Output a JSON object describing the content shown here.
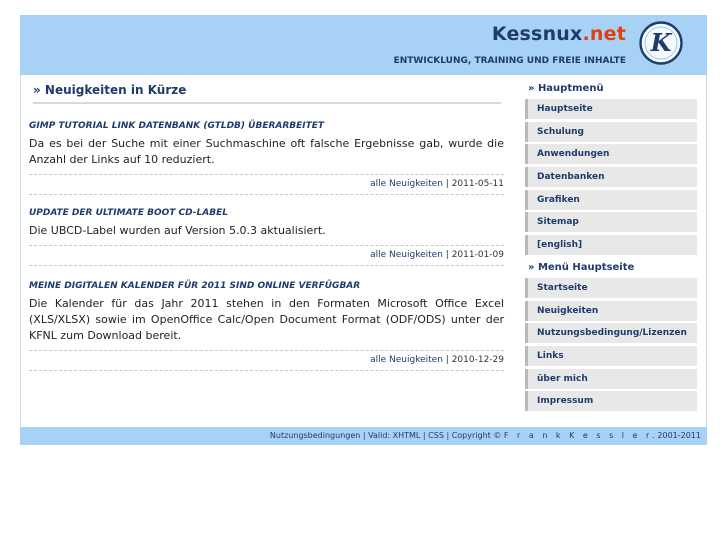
{
  "header": {
    "brand_name": "Kessnux",
    "brand_tld": ".net",
    "tagline": "ENTWICKLUNG, TRAINING UND FREIE INHALTE",
    "logo_letter": "K",
    "logo_icon": "k-circle-logo"
  },
  "content": {
    "title": "» Neuigkeiten in Kürze",
    "news": [
      {
        "title": "GIMP Tutorial Link Datenbank (GTLDB) überarbeitet",
        "body": "Da es bei der Suche mit einer Suchmaschine oft falsche Ergebnisse gab, wurde die Anzahl der Links auf 10 reduziert.",
        "link": "alle Neuigkeiten",
        "date": " | 2011-05-11"
      },
      {
        "title": "Update der Ultimate Boot CD-Label",
        "body": "Die UBCD-Label wurden auf Version 5.0.3 aktualisiert.",
        "link": "alle Neuigkeiten",
        "date": " | 2011-01-09"
      },
      {
        "title": "Meine digitalen Kalender für 2011 sind online verfügbar",
        "body": "Die Kalender für das Jahr 2011 stehen in den Formaten Microsoft Office Excel (XLS/XLSX) sowie im OpenOffice Calc/Open Document Format (ODF/ODS) unter der KFNL zum Download bereit.",
        "link": "alle Neuigkeiten",
        "date": " | 2010-12-29"
      }
    ]
  },
  "sidebar": {
    "main_heading": "» Hauptmenü",
    "main_items": [
      "Hauptseite",
      "Schulung",
      "Anwendungen",
      "Datenbanken",
      "Grafiken",
      "Sitemap",
      "[english]"
    ],
    "page_heading": "» Menü Hauptseite",
    "page_items": [
      "Startseite",
      "Neuigkeiten",
      "Nutzungsbedingung/Lizenzen",
      "Links",
      "über mich",
      "Impressum"
    ]
  },
  "footer": {
    "nutzung": "Nutzungsbedingungen",
    "sep1": " | Valid: ",
    "xhtml": "XHTML",
    "sep2": " | ",
    "css": "CSS",
    "copyright": " | Copyright © ",
    "author": "F r a n k   K e s s l e r",
    "years": ". 2001-2011"
  }
}
